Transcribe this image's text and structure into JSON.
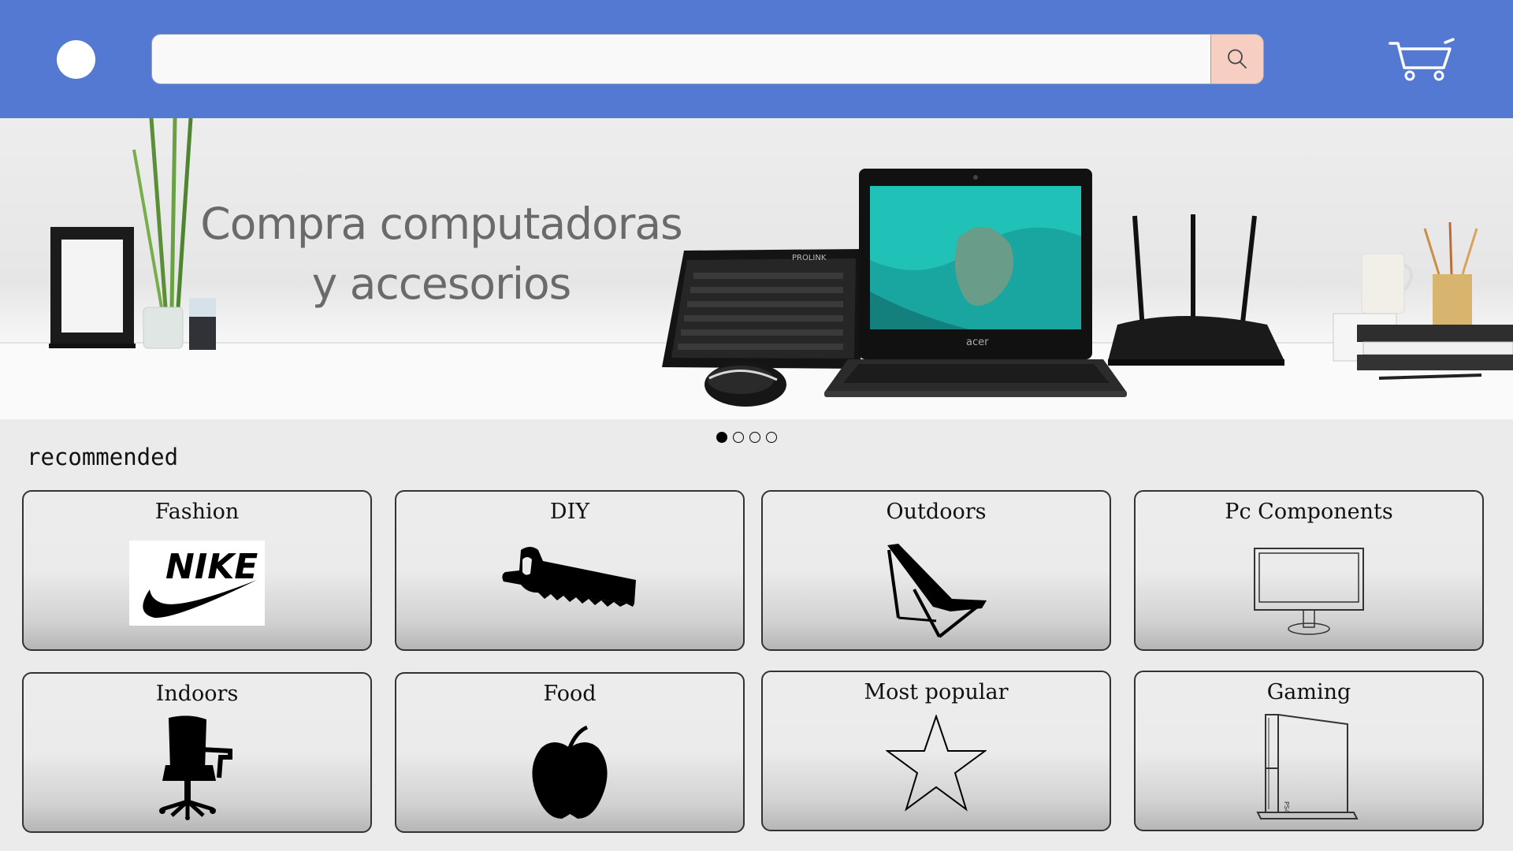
{
  "search": {
    "placeholder": "",
    "value": ""
  },
  "banner": {
    "headline_line1": "Compra computadoras",
    "headline_line2": "y accesorios",
    "slide_count": 4,
    "active_slide": 1
  },
  "section": {
    "title": "recommended"
  },
  "categories": [
    {
      "label": "Fashion",
      "icon": "nike-logo-icon"
    },
    {
      "label": "DIY",
      "icon": "saw-icon"
    },
    {
      "label": "Outdoors",
      "icon": "deck-chair-icon"
    },
    {
      "label": "Pc Components",
      "icon": "monitor-icon"
    },
    {
      "label": "Indoors",
      "icon": "office-chair-icon"
    },
    {
      "label": "Food",
      "icon": "apple-icon"
    },
    {
      "label": "Most popular",
      "icon": "star-icon"
    },
    {
      "label": "Gaming",
      "icon": "game-console-icon"
    }
  ],
  "logo_text": {
    "nike": "NIKE",
    "keyboard_brand": "PROLINK",
    "laptop_brand": "acer"
  },
  "colors": {
    "header": "#5479d3",
    "search_button": "#f6cfc2",
    "background": "#ebebeb"
  }
}
